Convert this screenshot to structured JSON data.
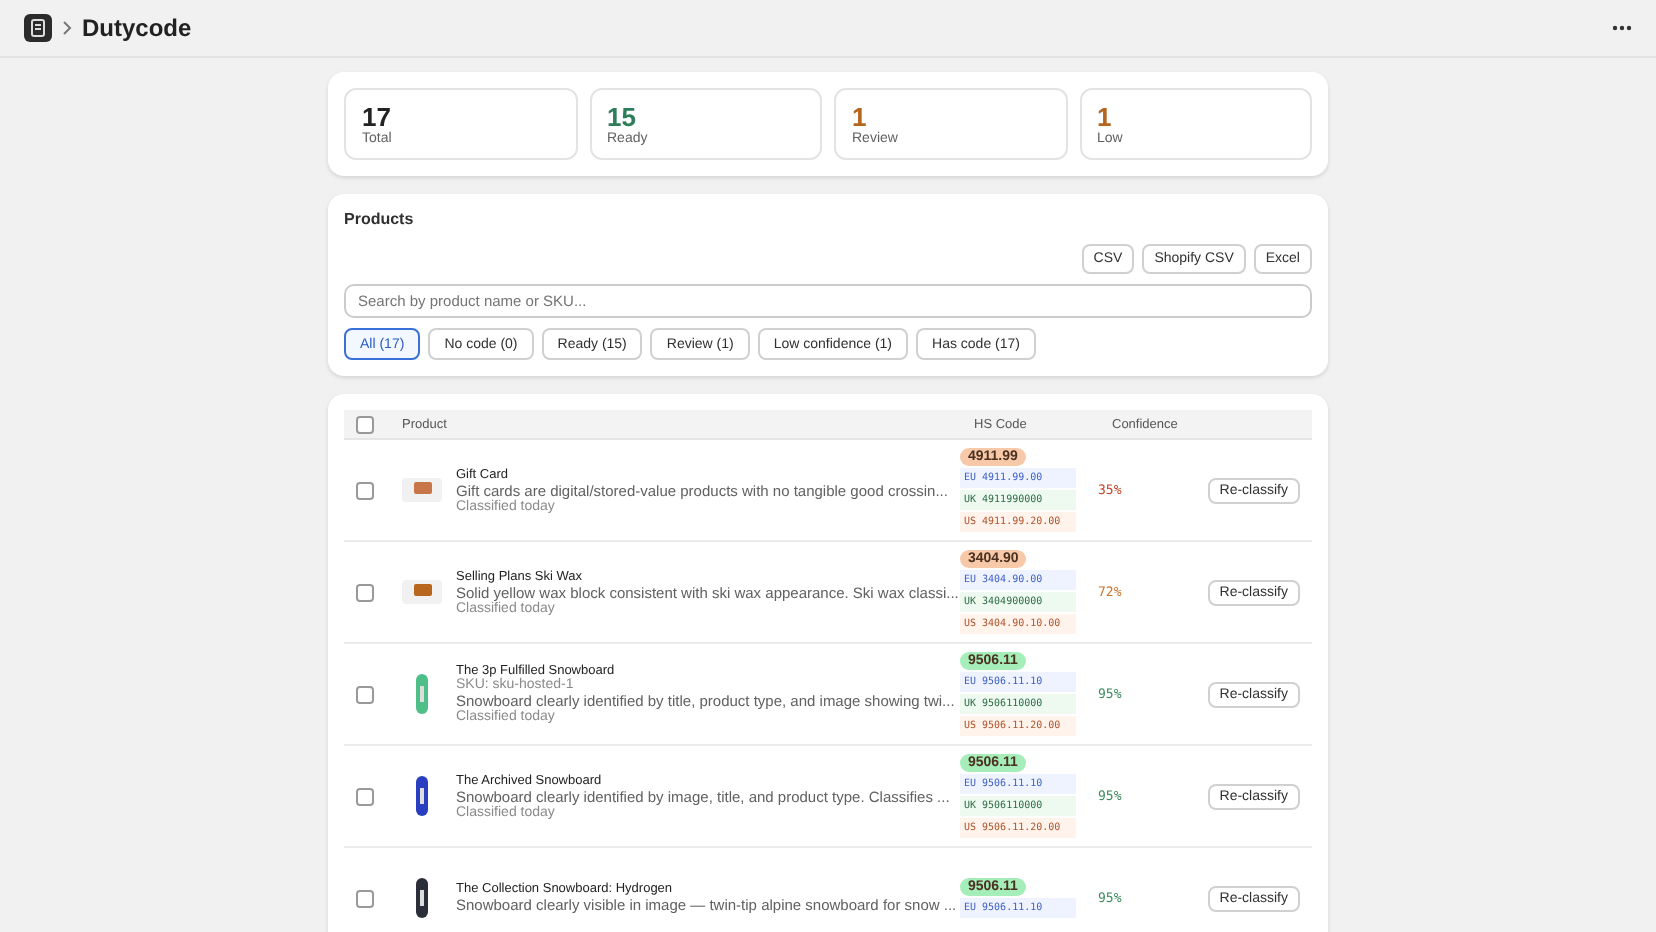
{
  "app": {
    "title": "Dutycode"
  },
  "stats": [
    {
      "value": "17",
      "label": "Total",
      "color": "#222222"
    },
    {
      "value": "15",
      "label": "Ready",
      "color": "#2e7d5b"
    },
    {
      "value": "1",
      "label": "Review",
      "color": "#b5651d"
    },
    {
      "value": "1",
      "label": "Low",
      "color": "#b5651d"
    }
  ],
  "products": {
    "title": "Products",
    "exports": [
      "CSV",
      "Shopify CSV",
      "Excel"
    ],
    "search": {
      "placeholder": "Search by product name or SKU..."
    },
    "filters": [
      {
        "label": "All (17)",
        "selected": true
      },
      {
        "label": "No code (0)",
        "selected": false
      },
      {
        "label": "Ready (15)",
        "selected": false
      },
      {
        "label": "Review (1)",
        "selected": false
      },
      {
        "label": "Low confidence (1)",
        "selected": false
      },
      {
        "label": "Has code (17)",
        "selected": false
      }
    ]
  },
  "table": {
    "columns": [
      "Product",
      "HS Code",
      "Confidence"
    ],
    "all_checked": false,
    "rows": [
      {
        "checked": false,
        "thumb": {
          "kind": "card",
          "color": "#c8754a"
        },
        "name": "Gift Card",
        "description": "Gift cards are digital/stored-value products with no tangible good crossin...",
        "classified": "Classified today",
        "code": {
          "label": "4911.99",
          "color": "#f7c9a8"
        },
        "eu": "EU 4911.99.00",
        "uk": "UK 4911990000",
        "us": "US 4911.99.20.00",
        "confidence": {
          "text": "35%",
          "color": "#c4452a"
        },
        "action": "Re-classify"
      },
      {
        "checked": false,
        "thumb": {
          "kind": "card",
          "color": "#b8651e"
        },
        "name": "Selling Plans Ski Wax",
        "description": "Solid yellow wax block consistent with ski wax appearance. Ski wax classi...",
        "classified": "Classified today",
        "code": {
          "label": "3404.90",
          "color": "#f7c9a8"
        },
        "eu": "EU 3404.90.00",
        "uk": "UK 3404900000",
        "us": "US 3404.90.10.00",
        "confidence": {
          "text": "72%",
          "color": "#c8762e"
        },
        "action": "Re-classify"
      },
      {
        "checked": false,
        "thumb": {
          "kind": "board",
          "color": "#4fbf8a"
        },
        "name": "The 3p Fulfilled Snowboard",
        "sku": "SKU: sku-hosted-1",
        "description": "Snowboard clearly identified by title, product type, and image showing twi...",
        "classified": "Classified today",
        "code": {
          "label": "9506.11",
          "color": "#a5eeb9"
        },
        "eu": "EU 9506.11.10",
        "uk": "UK 9506110000",
        "us": "US 9506.11.20.00",
        "confidence": {
          "text": "95%",
          "color": "#3d8a5f"
        },
        "action": "Re-classify"
      },
      {
        "checked": false,
        "thumb": {
          "kind": "board",
          "color": "#2a3fc0"
        },
        "name": "The Archived Snowboard",
        "description": "Snowboard clearly identified by image, title, and product type. Classifies ...",
        "classified": "Classified today",
        "code": {
          "label": "9506.11",
          "color": "#a5eeb9"
        },
        "eu": "EU 9506.11.10",
        "uk": "UK 9506110000",
        "us": "US 9506.11.20.00",
        "confidence": {
          "text": "95%",
          "color": "#3d8a5f"
        },
        "action": "Re-classify"
      },
      {
        "checked": false,
        "thumb": {
          "kind": "board",
          "color": "#2a2f3a"
        },
        "name": "The Collection Snowboard: Hydrogen",
        "description": "Snowboard clearly visible in image — twin-tip alpine snowboard for snow ...",
        "code": {
          "label": "9506.11",
          "color": "#a5eeb9"
        },
        "eu": "EU 9506.11.10",
        "confidence": {
          "text": "95%",
          "color": "#3d8a5f"
        },
        "action": "Re-classify"
      }
    ]
  }
}
